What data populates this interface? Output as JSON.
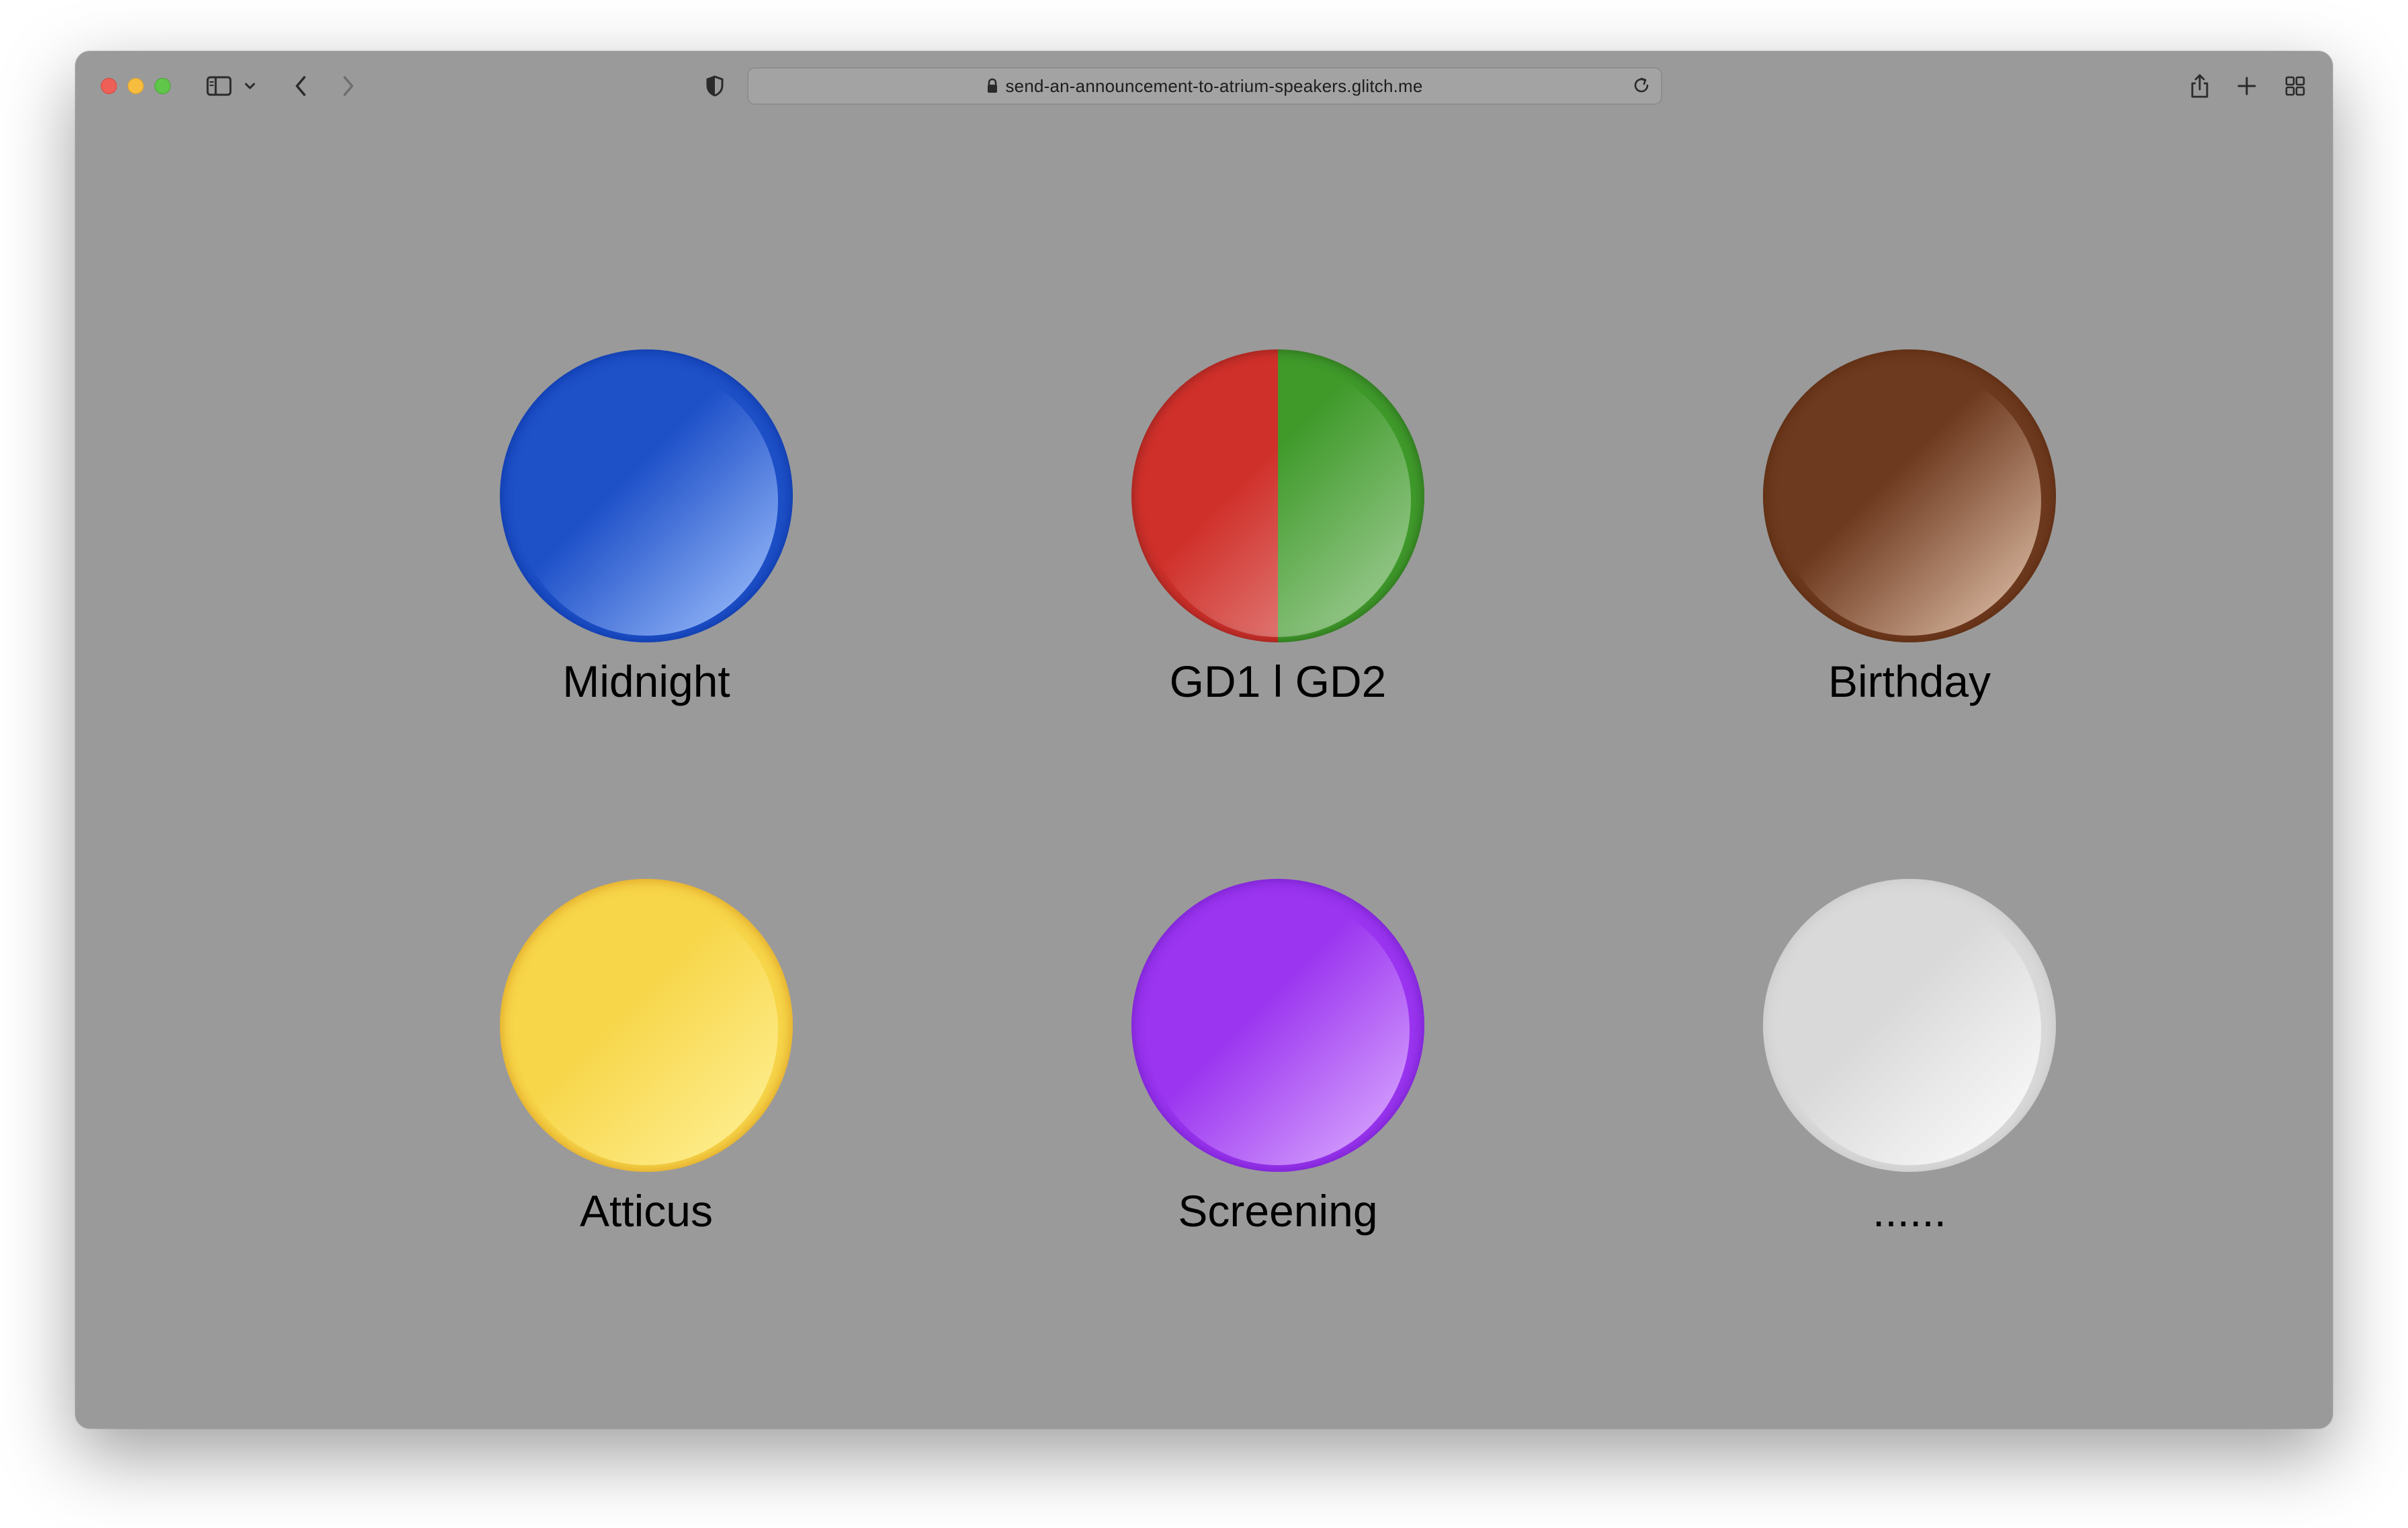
{
  "browser": {
    "url": "send-an-announcement-to-atrium-speakers.glitch.me",
    "icons": {
      "close": "close-dot",
      "minimize": "minimize-dot",
      "maximize": "maximize-dot",
      "sidebar": "sidebar-icon",
      "sidebar_menu": "chevron-down-icon",
      "back": "chevron-left-icon",
      "forward": "chevron-right-icon",
      "privacy": "shield-icon",
      "lock": "lock-icon",
      "reload": "reload-icon",
      "share": "share-icon",
      "new_tab": "plus-icon",
      "tab_overview": "grid-icon"
    }
  },
  "page": {
    "background": "#9a9a9a",
    "buttons": [
      {
        "label": "Midnight",
        "color": "#1e50c8",
        "light": "#a6c6ff",
        "dark": "#0b34a0"
      },
      {
        "label": "GD1 l GD2",
        "color": "#d0302a",
        "color_right": "#3f9a2a",
        "light": "#f3a5a3",
        "light_right": "#7be060"
      },
      {
        "label": "Birthday",
        "color": "#6e3a1f",
        "light": "#e8c9b2",
        "dark": "#58290f"
      },
      {
        "label": "Atticus",
        "color": "#f7d64a",
        "light": "#fff29a",
        "dark": "#d9961c"
      },
      {
        "label": "Screening",
        "color": "#9b35f0",
        "light": "#dfb3ff",
        "dark": "#6d1bc2"
      },
      {
        "label": "......",
        "color": "#d9d9d9",
        "light": "#ffffff",
        "dark": "#c6c6c6"
      }
    ]
  }
}
